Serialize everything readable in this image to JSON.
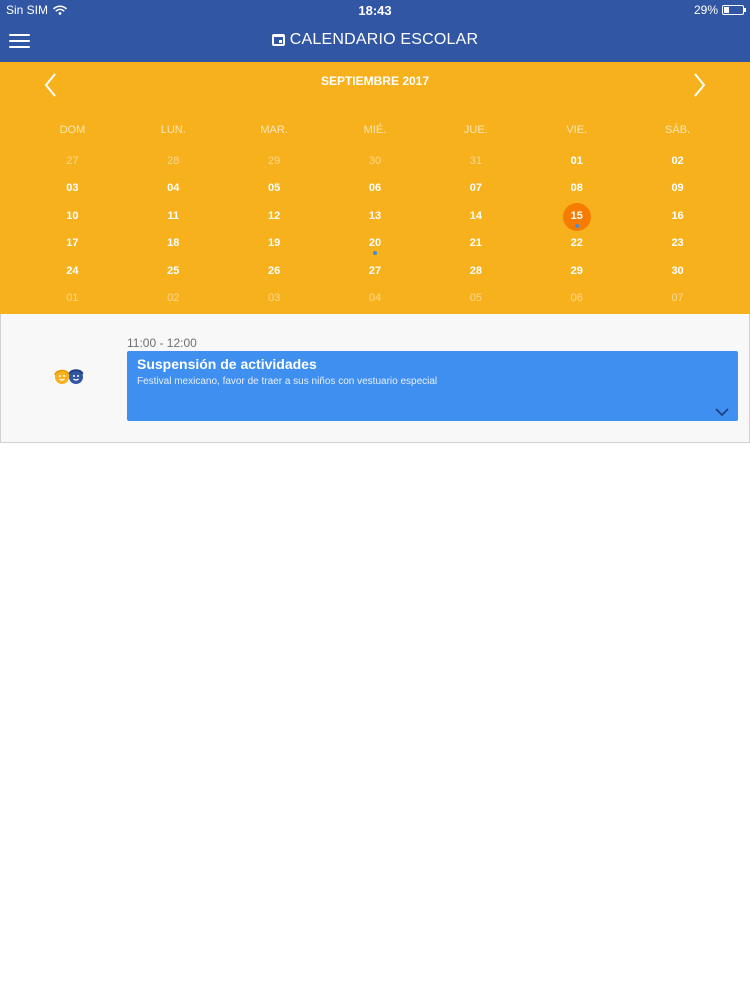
{
  "status_bar": {
    "carrier": "Sin SIM",
    "time": "18:43",
    "battery": "29%",
    "battery_level": 0.29
  },
  "nav": {
    "title": "CALENDARIO ESCOLAR",
    "menu_icon": "hamburger-menu-icon",
    "title_icon": "calendar-icon"
  },
  "calendar": {
    "month_label": "SEPTIEMBRE 2017",
    "weekdays": [
      "DOM",
      "LUN.",
      "MAR.",
      "MIÉ.",
      "JUE.",
      "VIE.",
      "SÁB."
    ],
    "days": [
      {
        "label": "27",
        "muted": true
      },
      {
        "label": "28",
        "muted": true
      },
      {
        "label": "29",
        "muted": true
      },
      {
        "label": "30",
        "muted": true
      },
      {
        "label": "31",
        "muted": true
      },
      {
        "label": "01"
      },
      {
        "label": "02"
      },
      {
        "label": "03"
      },
      {
        "label": "04"
      },
      {
        "label": "05"
      },
      {
        "label": "06"
      },
      {
        "label": "07"
      },
      {
        "label": "08"
      },
      {
        "label": "09"
      },
      {
        "label": "10"
      },
      {
        "label": "11"
      },
      {
        "label": "12"
      },
      {
        "label": "13"
      },
      {
        "label": "14"
      },
      {
        "label": "15",
        "today": true,
        "event": true
      },
      {
        "label": "16"
      },
      {
        "label": "17"
      },
      {
        "label": "18"
      },
      {
        "label": "19"
      },
      {
        "label": "20",
        "event": true
      },
      {
        "label": "21"
      },
      {
        "label": "22"
      },
      {
        "label": "23"
      },
      {
        "label": "24"
      },
      {
        "label": "25"
      },
      {
        "label": "26"
      },
      {
        "label": "27"
      },
      {
        "label": "28"
      },
      {
        "label": "29"
      },
      {
        "label": "30"
      },
      {
        "label": "01",
        "muted": true
      },
      {
        "label": "02",
        "muted": true
      },
      {
        "label": "03",
        "muted": true
      },
      {
        "label": "04",
        "muted": true
      },
      {
        "label": "05",
        "muted": true
      },
      {
        "label": "06",
        "muted": true
      },
      {
        "label": "07",
        "muted": true
      }
    ]
  },
  "event": {
    "time": "11:00 - 12:00",
    "title": "Suspensión de actividades",
    "description": "Festival mexicano, favor de traer a sus niños con vestuario especial",
    "icon": "kids-icon"
  },
  "colors": {
    "header": "#3156a3",
    "calendar_bg": "#f7b11d",
    "today_circle": "#f57c00",
    "event_card": "#3f8ff0"
  }
}
